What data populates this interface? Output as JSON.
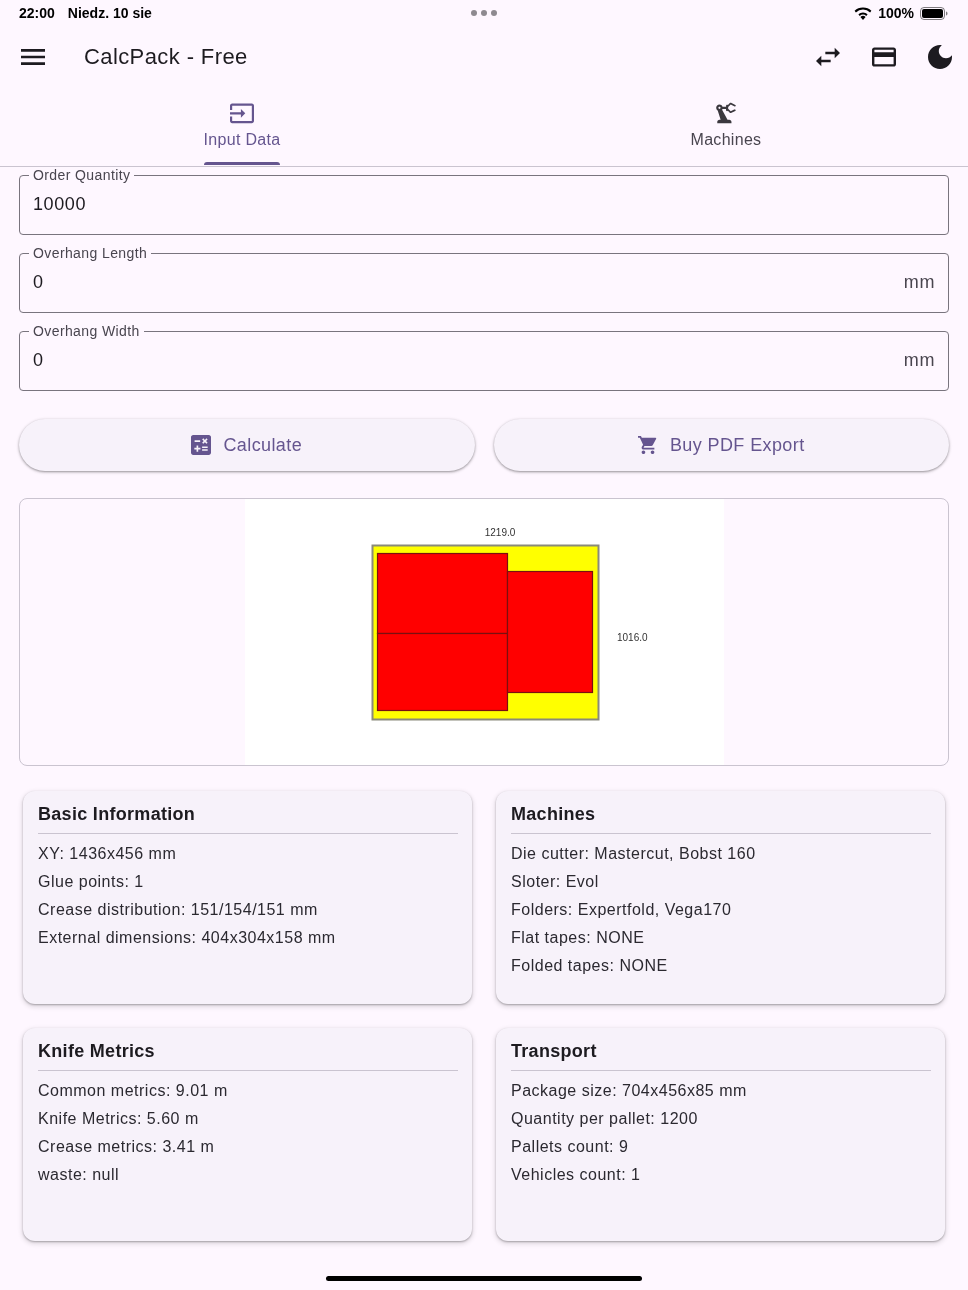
{
  "status_bar": {
    "time": "22:00",
    "date": "Niedz. 10 sie",
    "battery": "100%"
  },
  "app_bar": {
    "title": "CalcPack - Free"
  },
  "tabs": [
    {
      "label": "Input Data",
      "selected": true
    },
    {
      "label": "Machines",
      "selected": false
    }
  ],
  "fields": [
    {
      "label": "Order Quantity",
      "value": "10000"
    },
    {
      "label": "Overhang Length",
      "value": "0",
      "unit": "mm"
    },
    {
      "label": "Overhang Width",
      "value": "0",
      "unit": "mm"
    }
  ],
  "buttons": [
    {
      "label": "Calculate"
    },
    {
      "label": "Buy PDF Export"
    }
  ],
  "layout_diagram": {
    "width_label": "1219.0",
    "height_label": "1016.0"
  },
  "cards": [
    {
      "title": "Basic Information",
      "lines": [
        "XY: 1436x456 mm",
        "Glue points: 1",
        "Crease distribution: 151/154/151 mm",
        "External dimensions: 404x304x158 mm"
      ]
    },
    {
      "title": "Machines",
      "lines": [
        "Die cutter: Mastercut, Bobst 160",
        "Sloter: Evol",
        "Folders: Expertfold, Vega170",
        "Flat tapes: NONE",
        "Folded tapes: NONE"
      ]
    },
    {
      "title": "Knife Metrics",
      "lines": [
        "Common metrics: 9.01 m",
        "Knife Metrics: 5.60 m",
        "Crease metrics: 3.41 m",
        "waste: null"
      ]
    },
    {
      "title": "Transport",
      "lines": [
        "Package size: 704x456x85 mm",
        "Quantity per pallet: 1200",
        "Pallets count: 9",
        "Vehicles count: 1"
      ]
    }
  ]
}
